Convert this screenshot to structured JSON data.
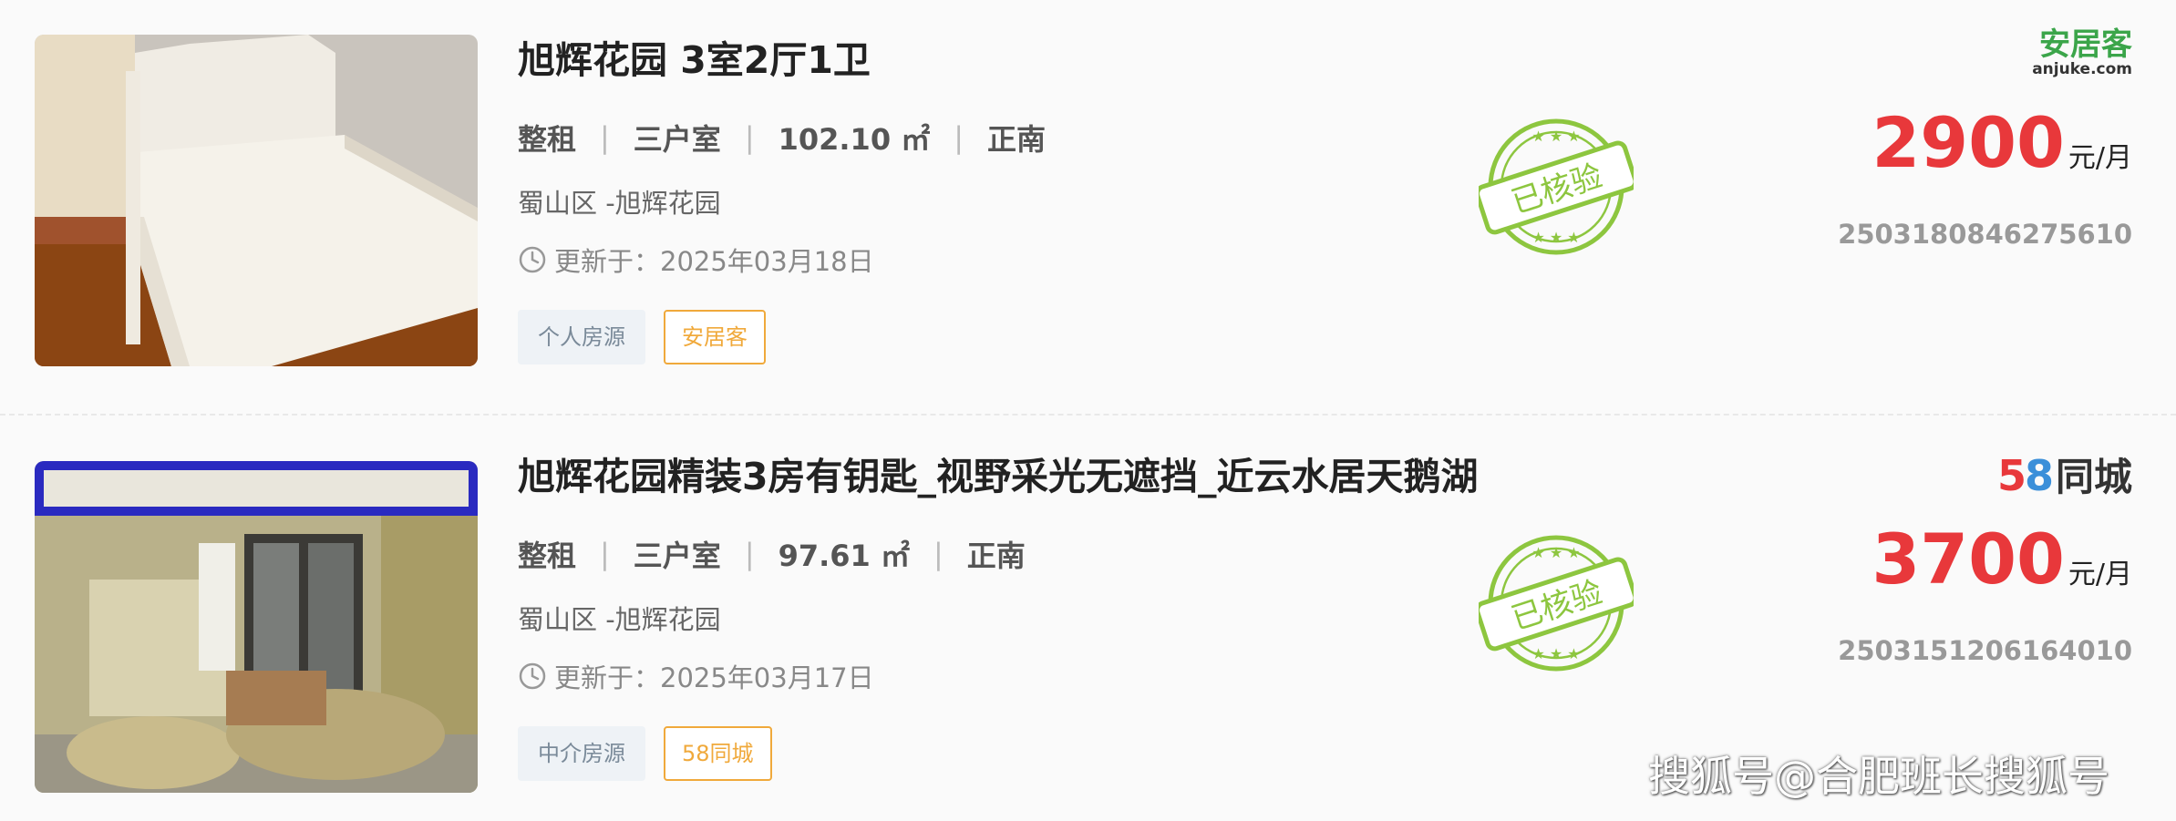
{
  "listings": [
    {
      "title": "旭辉花园 3室2厅1卫",
      "rent_type": "整租",
      "layout": "三户室",
      "area": "102.10 ㎡",
      "orientation": "正南",
      "address": "蜀山区 -旭辉花园",
      "updated": "更新于：2025年03月18日",
      "tag_source": "个人房源",
      "tag_platform": "安居客",
      "stamp_text": "已核验",
      "brand_cn": "安居客",
      "brand_en": "anjuke.com",
      "price": "2900",
      "price_unit": "元/月",
      "code": "2503180846275610"
    },
    {
      "title": "旭辉花园精装3房有钥匙_视野采光无遮挡_近云水居天鹅湖",
      "rent_type": "整租",
      "layout": "三户室",
      "area": "97.61 ㎡",
      "orientation": "正南",
      "address": "蜀山区 -旭辉花园",
      "updated": "更新于：2025年03月17日",
      "tag_source": "中介房源",
      "tag_platform": "58同城",
      "stamp_text": "已核验",
      "brand_num": "58",
      "brand_cn": "同城",
      "price": "3700",
      "price_unit": "元/月",
      "code": "2503151206164010"
    }
  ],
  "watermark": "搜狐号@合肥班长搜狐号",
  "colors": {
    "price": "#e8383b",
    "stamp": "#8dc63f",
    "tag_orange": "#f0a93b",
    "anjuke_green": "#3ba54a"
  }
}
